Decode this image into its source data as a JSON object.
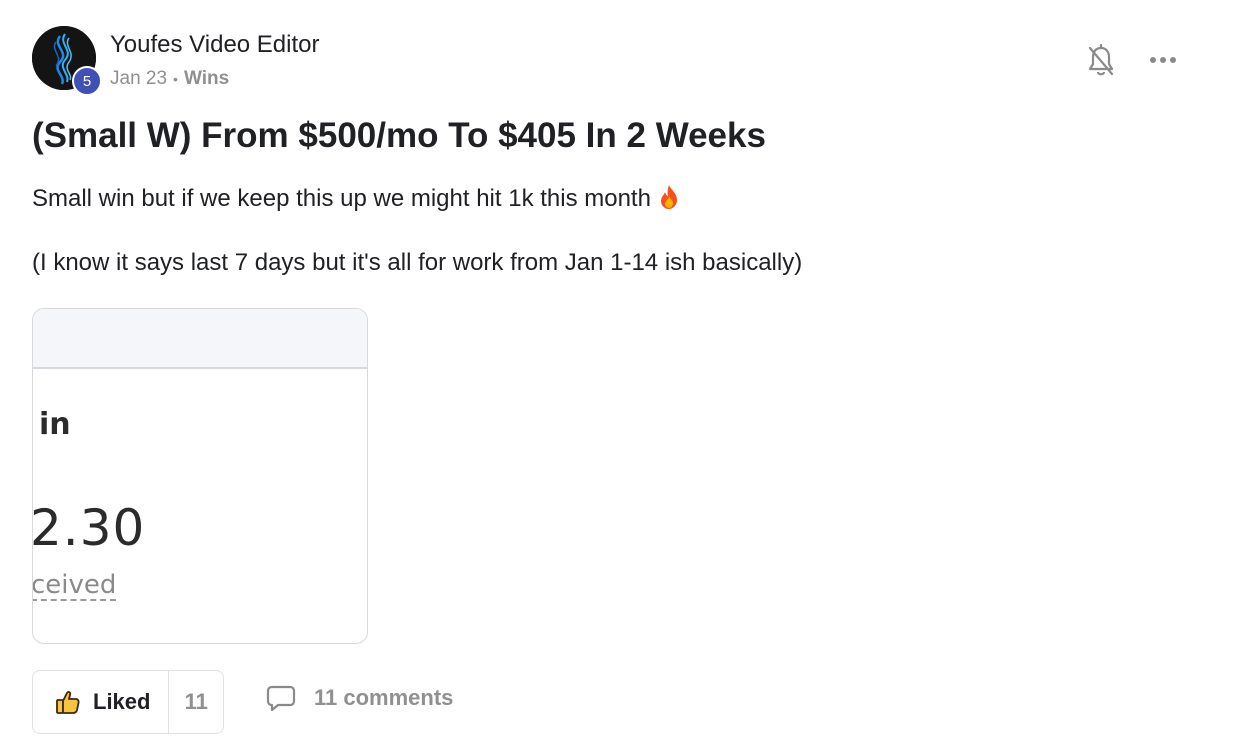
{
  "author": {
    "name": "Youfes Video Editor",
    "level": "5",
    "avatar_icon": "abstract-wave-logo"
  },
  "meta": {
    "date": "Jan 23",
    "separator": "•",
    "category": "Wins"
  },
  "actions": {
    "notify_icon": "bell-off-icon",
    "more_icon": "more-horizontal-icon"
  },
  "post": {
    "title": "(Small W) From $500/mo To $405 In 2 Weeks",
    "paragraph_1": "Small win but if we keep this up we might hit 1k this month",
    "paragraph_1_emoji": "fire-icon",
    "paragraph_2": "(I know it says last 7 days but it's all for work from Jan 1-14 ish basically)"
  },
  "attachment": {
    "label_text": "in",
    "amount_text": "2.30",
    "sub_text": "ceived"
  },
  "footer": {
    "like_label": "Liked",
    "like_count": "11",
    "comments_label": "11 comments"
  },
  "colors": {
    "level_badge": "#3f51b5",
    "muted_text": "#909090",
    "thumb_fill": "#f5c542"
  }
}
